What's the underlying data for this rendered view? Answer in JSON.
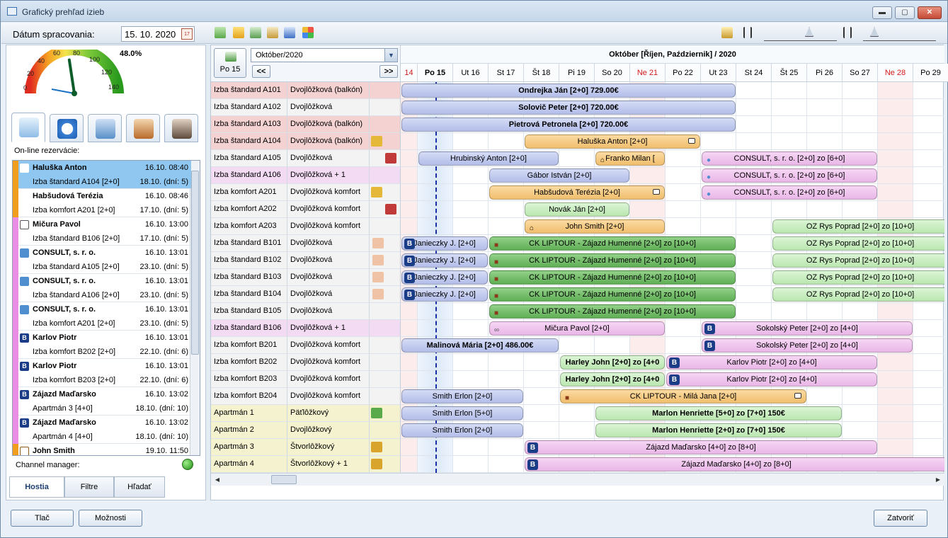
{
  "window": {
    "title": "Grafický prehľad izieb",
    "min": "▬",
    "max": "▢",
    "close": "✕"
  },
  "toolbar": {
    "date_label": "Dátum spracovania:",
    "date_value": "15. 10. 2020",
    "cal_icon": "17"
  },
  "gauge": {
    "percent": "48.0%",
    "value_fraction": 0.48,
    "ticks": [
      "0",
      "20",
      "40",
      "60",
      "80",
      "100",
      "120",
      "140"
    ]
  },
  "left": {
    "online_label": "On-line rezervácie:",
    "reservations": [
      {
        "name": "Haluška Anton",
        "date": "16.10. 08:40",
        "room": "Izba štandard A104 [2+0]",
        "to": "18.10. (dní: 5)",
        "bar": "#f19e1f",
        "icon": "comment-icon",
        "selected": true
      },
      {
        "name": "Habšudová Terézia",
        "date": "16.10. 08:46",
        "room": "Izba komfort A201 [2+0]",
        "to": "17.10. (dní: 5)",
        "bar": "#f19e1f",
        "icon": "comment-icon"
      },
      {
        "name": "Mičura Pavol",
        "date": "16.10. 13:00",
        "room": "Izba štandard B106 [2+0]",
        "to": "17.10. (dní: 5)",
        "bar": "#e98ee4",
        "icon": "link-icon"
      },
      {
        "name": "CONSULT, s. r. o.",
        "date": "16.10. 13:01",
        "room": "Izba štandard A105 [2+0]",
        "to": "23.10. (dní: 5)",
        "bar": "#e98ee4",
        "icon": "globe-icon"
      },
      {
        "name": "CONSULT, s. r. o.",
        "date": "16.10. 13:01",
        "room": "Izba štandard A106 [2+0]",
        "to": "23.10. (dní: 5)",
        "bar": "#e98ee4",
        "icon": "globe-icon"
      },
      {
        "name": "CONSULT, s. r. o.",
        "date": "16.10. 13:01",
        "room": "Izba komfort A201 [2+0]",
        "to": "23.10. (dní: 5)",
        "bar": "#e98ee4",
        "icon": "globe-icon"
      },
      {
        "name": "Karlov Piotr",
        "date": "16.10. 13:01",
        "room": "Izba komfort B202 [2+0]",
        "to": "22.10. (dní: 6)",
        "bar": "#e98ee4",
        "icon": "booking-icon"
      },
      {
        "name": "Karlov Piotr",
        "date": "16.10. 13:01",
        "room": "Izba komfort B203 [2+0]",
        "to": "22.10. (dní: 6)",
        "bar": "#e98ee4",
        "icon": "booking-icon"
      },
      {
        "name": "Zájazd Maďarsko",
        "date": "16.10. 13:02",
        "room": "Apartmán 3 [4+0]",
        "to": "18.10. (dní: 10)",
        "bar": "#e98ee4",
        "icon": "booking-icon"
      },
      {
        "name": "Zájazd Maďarsko",
        "date": "16.10. 13:02",
        "room": "Apartmán 4 [4+0]",
        "to": "18.10. (dní: 10)",
        "bar": "#e98ee4",
        "icon": "booking-icon"
      },
      {
        "name": "John Smith",
        "date": "19.10. 11:50",
        "room": "",
        "to": "",
        "bar": "#f19e1f",
        "icon": "home-icon"
      }
    ],
    "channel_manager": "Channel manager:",
    "tabs": [
      "Hostia",
      "Filtre",
      "Hľadať"
    ]
  },
  "grid": {
    "today_button": "Po 15",
    "month_select": "Október/2020",
    "prev": "<<",
    "next": ">>",
    "month_header": "Október  [Říjen, Październik] / 2020",
    "days": [
      {
        "label": "14",
        "weekend": true
      },
      {
        "label": "Po 15",
        "today": true
      },
      {
        "label": "Ut 16"
      },
      {
        "label": "St 17"
      },
      {
        "label": "Št 18"
      },
      {
        "label": "Pi 19"
      },
      {
        "label": "So 20"
      },
      {
        "label": "Ne 21",
        "weekend": true
      },
      {
        "label": "Po 22"
      },
      {
        "label": "Ut 23"
      },
      {
        "label": "St 24"
      },
      {
        "label": "Št 25"
      },
      {
        "label": "Pi 26"
      },
      {
        "label": "So 27"
      },
      {
        "label": "Ne 28",
        "weekend": true
      },
      {
        "label": "Po 29"
      }
    ],
    "rooms": [
      {
        "name": "Izba štandard A101",
        "type": "Dvojlôžková (balkón)",
        "bg": "#f4d2d2",
        "marker": ""
      },
      {
        "name": "Izba štandard A102",
        "type": "Dvojlôžková",
        "bg": "#f3f3f3",
        "marker": ""
      },
      {
        "name": "Izba štandard A103",
        "type": "Dvojlôžková (balkón)",
        "bg": "#f4d2d2",
        "marker": ""
      },
      {
        "name": "Izba štandard A104",
        "type": "Dvojlôžková (balkón)",
        "bg": "#f4d2d2",
        "marker": "broom-icon"
      },
      {
        "name": "Izba štandard A105",
        "type": "Dvojlôžková",
        "bg": "#f3f3f3",
        "marker": "wrench-icon"
      },
      {
        "name": "Izba štandard A106",
        "type": "Dvojlôžková + 1",
        "bg": "#f3dcf3",
        "marker": ""
      },
      {
        "name": "Izba komfort A201",
        "type": "Dvojlôžková komfort",
        "bg": "#f3f3f3",
        "marker": "broom-icon"
      },
      {
        "name": "Izba komfort A202",
        "type": "Dvojlôžková komfort",
        "bg": "#f3f3f3",
        "marker": "wrench-icon"
      },
      {
        "name": "Izba komfort A203",
        "type": "Dvojlôžková komfort",
        "bg": "#f3f3f3",
        "marker": ""
      },
      {
        "name": "Izba štandard B101",
        "type": "Dvojlôžková",
        "bg": "#f3f3f3",
        "marker": "pillow-icon"
      },
      {
        "name": "Izba štandard B102",
        "type": "Dvojlôžková",
        "bg": "#f3f3f3",
        "marker": "pillow-icon"
      },
      {
        "name": "Izba štandard B103",
        "type": "Dvojlôžková",
        "bg": "#f3f3f3",
        "marker": "pillow-icon"
      },
      {
        "name": "Izba štandard B104",
        "type": "Dvojlôžková",
        "bg": "#f3f3f3",
        "marker": "pillow-icon"
      },
      {
        "name": "Izba štandard B105",
        "type": "Dvojlôžková",
        "bg": "#f3f3f3",
        "marker": ""
      },
      {
        "name": "Izba štandard B106",
        "type": "Dvojlôžková + 1",
        "bg": "#f3dcf3",
        "marker": ""
      },
      {
        "name": "Izba komfort B201",
        "type": "Dvojlôžková komfort",
        "bg": "#f3f3f3",
        "marker": ""
      },
      {
        "name": "Izba komfort B202",
        "type": "Dvojlôžková komfort",
        "bg": "#f3f3f3",
        "marker": ""
      },
      {
        "name": "Izba komfort B203",
        "type": "Dvojlôžková komfort",
        "bg": "#f3f3f3",
        "marker": ""
      },
      {
        "name": "Izba komfort B204",
        "type": "Dvojlôžková komfort",
        "bg": "#f3f3f3",
        "marker": ""
      },
      {
        "name": "Apartmán 1",
        "type": "Päťlôžkový",
        "bg": "#f4f2cf",
        "marker": "check-broom-icon"
      },
      {
        "name": "Apartmán 2",
        "type": "Dvojlôžkový",
        "bg": "#f4f2cf",
        "marker": ""
      },
      {
        "name": "Apartmán 3",
        "type": "Štvorlôžkový",
        "bg": "#f4f2cf",
        "marker": "clock-broom-icon"
      },
      {
        "name": "Apartmán 4",
        "type": "Štvorlôžkový + 1",
        "bg": "#f4f2cf",
        "marker": "clock-broom-icon"
      }
    ],
    "bookings": [
      {
        "row": 0,
        "start": 0,
        "end": 10,
        "text": "Ondrejka Ján [2+0]  729.00€",
        "color": "blue",
        "bold": true
      },
      {
        "row": 1,
        "start": 0,
        "end": 10,
        "text": "Solovič Peter [2+0]  720.00€",
        "color": "blue",
        "bold": true
      },
      {
        "row": 2,
        "start": 0,
        "end": 10,
        "text": "Pietrová Petronela [2+0]  720.00€",
        "color": "blue",
        "bold": true
      },
      {
        "row": 3,
        "start": 4,
        "end": 9,
        "text": "Haluška Anton [2+0]",
        "color": "orange",
        "comment": true
      },
      {
        "row": 4,
        "start": 1,
        "end": 5,
        "text": "Hrubinský Anton [2+0]",
        "color": "blue"
      },
      {
        "row": 4,
        "start": 6,
        "end": 8,
        "text": "Franko Milan [",
        "color": "orange",
        "home": true
      },
      {
        "row": 4,
        "start": 9,
        "end": 14,
        "text": "CONSULT, s. r. o. [2+0] zo [6+0]",
        "color": "pink",
        "globe": true
      },
      {
        "row": 5,
        "start": 3,
        "end": 7,
        "text": "Gábor István [2+0]",
        "color": "blue"
      },
      {
        "row": 5,
        "start": 9,
        "end": 14,
        "text": "CONSULT, s. r. o. [2+0] zo [6+0]",
        "color": "pink",
        "globe": true
      },
      {
        "row": 6,
        "start": 3,
        "end": 8,
        "text": "Habšudová Terézia [2+0]",
        "color": "orange",
        "comment": true
      },
      {
        "row": 6,
        "start": 9,
        "end": 14,
        "text": "CONSULT, s. r. o. [2+0] zo [6+0]",
        "color": "pink",
        "globe": true
      },
      {
        "row": 7,
        "start": 4,
        "end": 7,
        "text": "Novák Ján [2+0]",
        "color": "green"
      },
      {
        "row": 8,
        "start": 4,
        "end": 8,
        "text": "John Smith [2+0]",
        "color": "orange",
        "home": true
      },
      {
        "row": 8,
        "start": 11,
        "end": 16,
        "text": "OZ Rys Poprad [2+0] zo [10+0]",
        "color": "green"
      },
      {
        "row": 9,
        "start": 0,
        "end": 3,
        "text": "Janieczky J. [2+0]",
        "color": "blue",
        "booking": true
      },
      {
        "row": 9,
        "start": 3,
        "end": 10,
        "text": "CK LIPTOUR - Zájazd Humenné [2+0] zo [10+0]",
        "color": "dgreen",
        "bag": true
      },
      {
        "row": 9,
        "start": 11,
        "end": 16,
        "text": "OZ Rys Poprad [2+0] zo [10+0]",
        "color": "green"
      },
      {
        "row": 10,
        "start": 0,
        "end": 3,
        "text": "Janieczky J. [2+0]",
        "color": "blue",
        "booking": true
      },
      {
        "row": 10,
        "start": 3,
        "end": 10,
        "text": "CK LIPTOUR - Zájazd Humenné [2+0] zo [10+0]",
        "color": "dgreen",
        "bag": true
      },
      {
        "row": 10,
        "start": 11,
        "end": 16,
        "text": "OZ Rys Poprad [2+0] zo [10+0]",
        "color": "green"
      },
      {
        "row": 11,
        "start": 0,
        "end": 3,
        "text": "Janieczky J. [2+0]",
        "color": "blue",
        "booking": true
      },
      {
        "row": 11,
        "start": 3,
        "end": 10,
        "text": "CK LIPTOUR - Zájazd Humenné [2+0] zo [10+0]",
        "color": "dgreen",
        "bag": true
      },
      {
        "row": 11,
        "start": 11,
        "end": 16,
        "text": "OZ Rys Poprad [2+0] zo [10+0]",
        "color": "green"
      },
      {
        "row": 12,
        "start": 0,
        "end": 3,
        "text": "Janieczky J. [2+0]",
        "color": "blue",
        "booking": true
      },
      {
        "row": 12,
        "start": 3,
        "end": 10,
        "text": "CK LIPTOUR - Zájazd Humenné [2+0] zo [10+0]",
        "color": "dgreen",
        "bag": true
      },
      {
        "row": 12,
        "start": 11,
        "end": 16,
        "text": "OZ Rys Poprad [2+0] zo [10+0]",
        "color": "green"
      },
      {
        "row": 13,
        "start": 3,
        "end": 10,
        "text": "CK LIPTOUR - Zájazd Humenné [2+0] zo [10+0]",
        "color": "dgreen",
        "bag": true
      },
      {
        "row": 14,
        "start": 3,
        "end": 8,
        "text": "Mičura Pavol [2+0]",
        "color": "pink",
        "link": true
      },
      {
        "row": 14,
        "start": 9,
        "end": 15,
        "text": "Sokolský Peter [2+0] zo [4+0]",
        "color": "pink",
        "booking": true
      },
      {
        "row": 15,
        "start": 0,
        "end": 5,
        "text": "Malinová Mária [2+0]  486.00€",
        "color": "blue",
        "bold": true
      },
      {
        "row": 15,
        "start": 9,
        "end": 15,
        "text": "Sokolský Peter [2+0] zo [4+0]",
        "color": "pink",
        "booking": true
      },
      {
        "row": 16,
        "start": 5,
        "end": 8,
        "text": "Harley John [2+0] zo [4+0",
        "color": "green",
        "bold": true
      },
      {
        "row": 16,
        "start": 8,
        "end": 14,
        "text": "Karlov Piotr [2+0] zo [4+0]",
        "color": "pink",
        "booking": true
      },
      {
        "row": 17,
        "start": 5,
        "end": 8,
        "text": "Harley John [2+0] zo [4+0",
        "color": "green",
        "bold": true
      },
      {
        "row": 17,
        "start": 8,
        "end": 14,
        "text": "Karlov Piotr [2+0] zo [4+0]",
        "color": "pink",
        "booking": true
      },
      {
        "row": 18,
        "start": 0,
        "end": 4,
        "text": "Smith Erlon [2+0]",
        "color": "blue"
      },
      {
        "row": 18,
        "start": 5,
        "end": 12,
        "text": "CK LIPTOUR - Milá Jana [2+0]",
        "color": "orange",
        "bag": true,
        "comment": true
      },
      {
        "row": 19,
        "start": 0,
        "end": 4,
        "text": "Smith Erlon [5+0]",
        "color": "blue"
      },
      {
        "row": 19,
        "start": 6,
        "end": 13,
        "text": "Marlon Henriette [5+0] zo [7+0]   150€",
        "color": "green",
        "bold": true
      },
      {
        "row": 20,
        "start": 0,
        "end": 4,
        "text": "Smith Erlon [2+0]",
        "color": "blue"
      },
      {
        "row": 20,
        "start": 6,
        "end": 13,
        "text": "Marlon Henriette [2+0] zo [7+0]   150€",
        "color": "green",
        "bold": true
      },
      {
        "row": 21,
        "start": 4,
        "end": 14,
        "text": "Zájazd Maďarsko [4+0] zo [8+0]",
        "color": "pink",
        "booking": true
      },
      {
        "row": 22,
        "start": 4,
        "end": 16,
        "text": "Zájazd Maďarsko [4+0] zo [8+0]",
        "color": "pink",
        "booking": true
      }
    ]
  },
  "footer": {
    "print": "Tlač",
    "options": "Možnosti",
    "close": "Zatvoriť"
  }
}
